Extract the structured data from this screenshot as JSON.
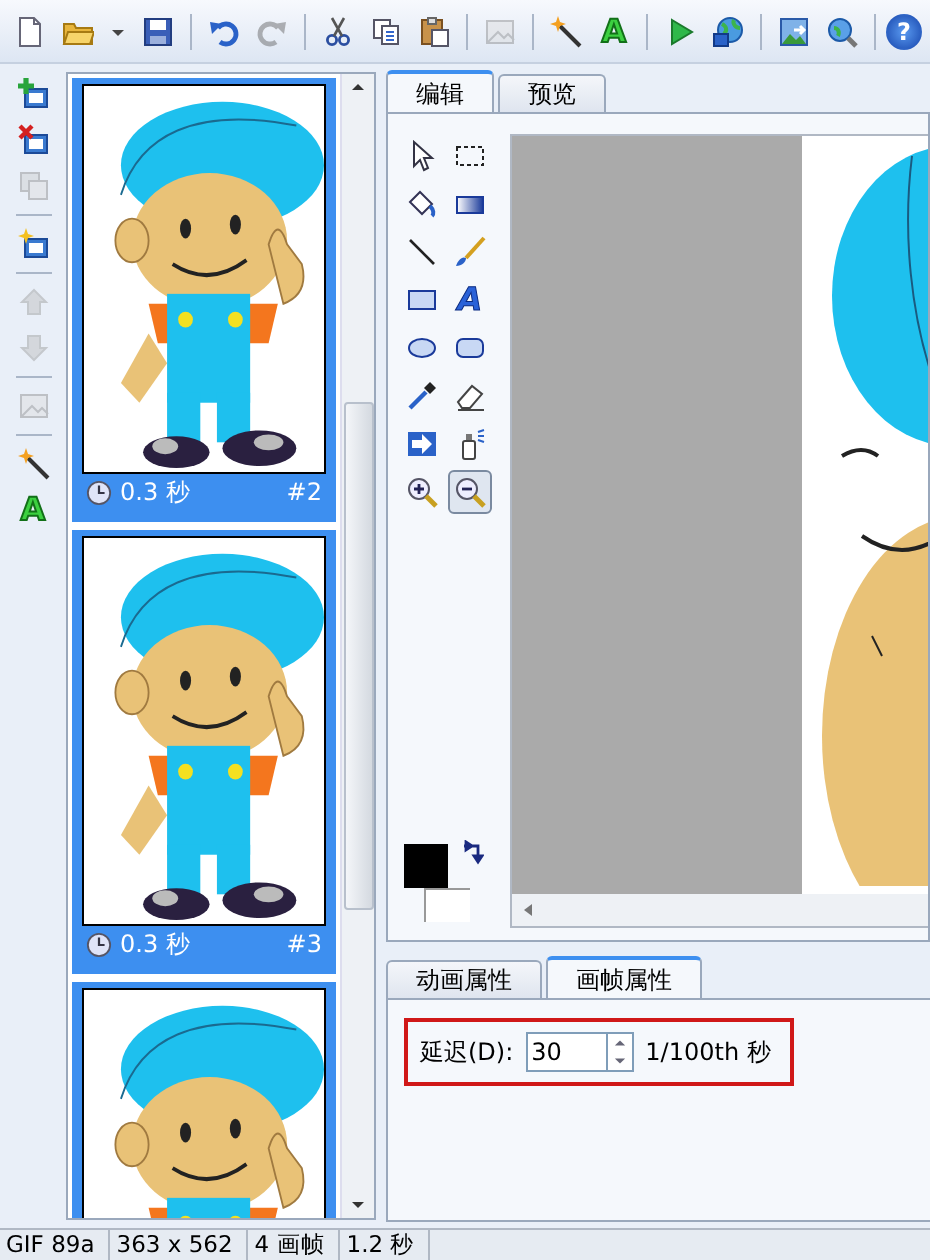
{
  "toolbar": [
    [
      {
        "kind": "new",
        "disabled": false
      },
      {
        "kind": "open",
        "disabled": false
      },
      {
        "kind": "dropdown",
        "disabled": false
      },
      {
        "kind": "save",
        "disabled": false
      }
    ],
    [
      {
        "kind": "undo",
        "disabled": false
      },
      {
        "kind": "redo",
        "disabled": true
      }
    ],
    [
      {
        "kind": "cut",
        "disabled": false
      },
      {
        "kind": "copy",
        "disabled": false
      },
      {
        "kind": "paste",
        "disabled": false
      }
    ],
    [
      {
        "kind": "crop",
        "disabled": true
      }
    ],
    [
      {
        "kind": "wand",
        "disabled": false
      },
      {
        "kind": "text",
        "glyph": "A",
        "disabled": false
      }
    ],
    [
      {
        "kind": "play",
        "disabled": false
      },
      {
        "kind": "preview",
        "disabled": false
      }
    ],
    [
      {
        "kind": "image",
        "disabled": false
      },
      {
        "kind": "browse",
        "disabled": false
      }
    ],
    [
      {
        "kind": "help",
        "glyph": "?",
        "disabled": false
      }
    ]
  ],
  "frame_tools": [
    [
      {
        "kind": "add_frame",
        "disabled": false
      },
      {
        "kind": "delete_frame",
        "disabled": false
      },
      {
        "kind": "duplicate",
        "disabled": true
      }
    ],
    [
      {
        "kind": "insert_frame",
        "disabled": false
      }
    ],
    [
      {
        "kind": "up",
        "disabled": true
      },
      {
        "kind": "down",
        "disabled": true
      }
    ],
    [
      {
        "kind": "crop",
        "disabled": true
      }
    ],
    [
      {
        "kind": "wand",
        "disabled": false
      },
      {
        "kind": "text",
        "glyph": "A",
        "disabled": false
      }
    ]
  ],
  "frames": [
    {
      "delay": "0.3 秒",
      "number": "#2",
      "selected": true
    },
    {
      "delay": "0.3 秒",
      "number": "#3",
      "selected": true
    },
    {
      "selected": true
    }
  ],
  "editor_tabs": [
    {
      "label": "编辑",
      "selected": true
    },
    {
      "label": "预览",
      "selected": false
    }
  ],
  "tools": [
    {
      "kind": "pointer",
      "selected": false
    },
    {
      "kind": "marquee",
      "selected": false
    },
    {
      "kind": "fill",
      "selected": false
    },
    {
      "kind": "gradient",
      "selected": false
    },
    {
      "kind": "line",
      "selected": false
    },
    {
      "kind": "brush",
      "selected": false
    },
    {
      "kind": "rect",
      "selected": false
    },
    {
      "kind": "text",
      "glyph": "A",
      "selected": false
    },
    {
      "kind": "ellipse",
      "selected": false
    },
    {
      "kind": "roundrect",
      "selected": false
    },
    {
      "kind": "eyedropper",
      "selected": false
    },
    {
      "kind": "eraser",
      "selected": false
    },
    {
      "kind": "export",
      "selected": false
    },
    {
      "kind": "spray",
      "selected": false
    },
    {
      "kind": "zoom_in",
      "selected": false
    },
    {
      "kind": "zoom_out",
      "selected": true
    }
  ],
  "property_tabs": [
    {
      "label": "动画属性",
      "selected": false
    },
    {
      "label": "画帧属性",
      "selected": true
    }
  ],
  "delay_field": {
    "label": "延迟(D):",
    "value": "30",
    "unit": "1/100th 秒"
  },
  "status_bar": [
    "GIF 89a",
    "363 x 562",
    "4 画帧",
    "1.2 秒"
  ]
}
